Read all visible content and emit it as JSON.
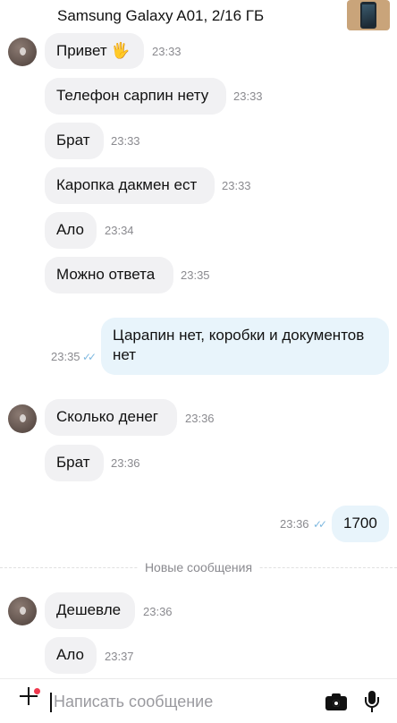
{
  "header": {
    "title": "Samsung Galaxy A01, 2/16 ГБ"
  },
  "messages": [
    {
      "text": "Привет 🖐",
      "time": "23:33"
    },
    {
      "text": "Телефон сарпин нету",
      "time": "23:33"
    },
    {
      "text": "Брат",
      "time": "23:33"
    },
    {
      "text": "Каропка дакмен ест",
      "time": "23:33"
    },
    {
      "text": "Ало",
      "time": "23:34"
    },
    {
      "text": "Можно ответа",
      "time": "23:35"
    },
    {
      "text": "Царапин нет, коробки и документов нет",
      "time": "23:35",
      "status": "✓✓"
    },
    {
      "text": "Сколько денег",
      "time": "23:36"
    },
    {
      "text": "Брат",
      "time": "23:36"
    },
    {
      "text": "1700",
      "time": "23:36",
      "status": "✓✓"
    },
    {
      "text": "Дешевле",
      "time": "23:36"
    },
    {
      "text": "Ало",
      "time": "23:37"
    }
  ],
  "divider": {
    "label": "Новые сообщения"
  },
  "composer": {
    "placeholder": "Написать сообщение"
  },
  "colors": {
    "incoming_bubble": "#f1f1f3",
    "outgoing_bubble": "#e8f4fb",
    "unread_dot": "#f0394f",
    "read_ticks": "#7fb9e0"
  }
}
